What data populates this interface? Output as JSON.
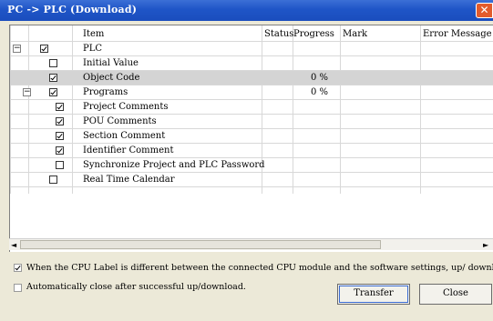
{
  "window": {
    "title": "PC -> PLC (Download)",
    "close_glyph": "✕"
  },
  "table": {
    "headers": {
      "item": "Item",
      "status": "Status",
      "progress": "Progress",
      "mark": "Mark",
      "error": "Error Message"
    },
    "rows": [
      {
        "label": "PLC",
        "checked": true,
        "progress": "",
        "tree": "minus",
        "indent": 0
      },
      {
        "label": "Initial Value",
        "checked": false,
        "progress": "",
        "tree": "",
        "indent": 1
      },
      {
        "label": "Object Code",
        "checked": true,
        "progress": "0 %",
        "tree": "",
        "indent": 1,
        "selected": true
      },
      {
        "label": "Programs",
        "checked": true,
        "progress": "0 %",
        "tree": "minus",
        "indent": 1
      },
      {
        "label": "Project Comments",
        "checked": true,
        "progress": "",
        "tree": "",
        "indent": 2
      },
      {
        "label": "POU Comments",
        "checked": true,
        "progress": "",
        "tree": "",
        "indent": 2
      },
      {
        "label": "Section Comment",
        "checked": true,
        "progress": "",
        "tree": "",
        "indent": 2
      },
      {
        "label": "Identifier Comment",
        "checked": true,
        "progress": "",
        "tree": "",
        "indent": 2
      },
      {
        "label": "Synchronize Project and PLC Password",
        "checked": false,
        "progress": "",
        "tree": "",
        "indent": 2
      },
      {
        "label": "Real Time Calendar",
        "checked": false,
        "progress": "",
        "tree": "",
        "indent": 1
      }
    ]
  },
  "options": {
    "cpu_label_text": "When the CPU Label is different between the connected CPU module and the software settings, up/ download still cont",
    "cpu_label_checked": true,
    "auto_close_text": "Automatically close after successful up/download.",
    "auto_close_checked": false
  },
  "buttons": {
    "transfer": "Transfer",
    "close": "Close"
  },
  "scrollbar": {
    "left_arrow": "◄",
    "right_arrow": "►"
  },
  "colors": {
    "titlebar": "#1f55c7",
    "close_button": "#e25b2c",
    "selected_row": "#d4d4d4"
  }
}
